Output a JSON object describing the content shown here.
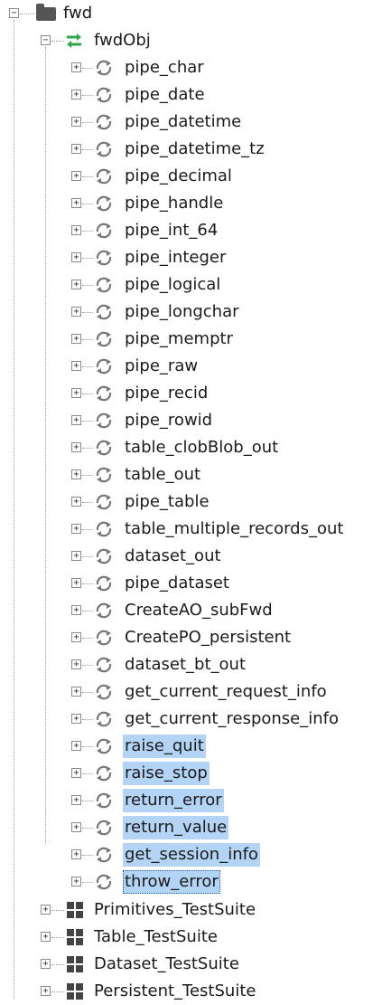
{
  "tree": {
    "root": {
      "label": "fwd",
      "icon": "folder-icon",
      "expander": "−"
    },
    "package": {
      "label": "fwdObj",
      "icon": "sync-arrows-icon",
      "icon_color": "#2aa84a",
      "expander": "−"
    },
    "items": [
      {
        "label": "pipe_char",
        "selected": false
      },
      {
        "label": "pipe_date",
        "selected": false
      },
      {
        "label": "pipe_datetime",
        "selected": false
      },
      {
        "label": "pipe_datetime_tz",
        "selected": false
      },
      {
        "label": "pipe_decimal",
        "selected": false
      },
      {
        "label": "pipe_handle",
        "selected": false
      },
      {
        "label": "pipe_int_64",
        "selected": false
      },
      {
        "label": "pipe_integer",
        "selected": false
      },
      {
        "label": "pipe_logical",
        "selected": false
      },
      {
        "label": "pipe_longchar",
        "selected": false
      },
      {
        "label": "pipe_memptr",
        "selected": false
      },
      {
        "label": "pipe_raw",
        "selected": false
      },
      {
        "label": "pipe_recid",
        "selected": false
      },
      {
        "label": "pipe_rowid",
        "selected": false
      },
      {
        "label": "table_clobBlob_out",
        "selected": false
      },
      {
        "label": "table_out",
        "selected": false
      },
      {
        "label": "pipe_table",
        "selected": false
      },
      {
        "label": "table_multiple_records_out",
        "selected": false
      },
      {
        "label": "dataset_out",
        "selected": false
      },
      {
        "label": "pipe_dataset",
        "selected": false
      },
      {
        "label": "CreateAO_subFwd",
        "selected": false
      },
      {
        "label": "CreatePO_persistent",
        "selected": false
      },
      {
        "label": "dataset_bt_out",
        "selected": false
      },
      {
        "label": "get_current_request_info",
        "selected": false
      },
      {
        "label": "get_current_response_info",
        "selected": false
      },
      {
        "label": "raise_quit",
        "selected": true
      },
      {
        "label": "raise_stop",
        "selected": true
      },
      {
        "label": "return_error",
        "selected": true
      },
      {
        "label": "return_value",
        "selected": true
      },
      {
        "label": "get_session_info",
        "selected": true
      },
      {
        "label": "throw_error",
        "selected": true,
        "focused": true
      }
    ],
    "item_icon": "refresh-circle-icon",
    "item_expander": "+",
    "suites": [
      {
        "label": "Primitives_TestSuite"
      },
      {
        "label": "Table_TestSuite"
      },
      {
        "label": "Dataset_TestSuite"
      },
      {
        "label": "Persistent_TestSuite"
      }
    ],
    "suite_icon": "grid-icon",
    "suite_expander": "+",
    "selection_color": "#b3d4f5"
  }
}
